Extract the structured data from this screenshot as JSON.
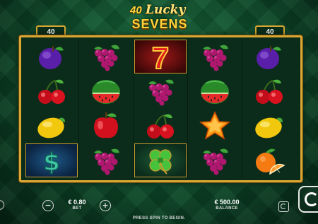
{
  "logo": {
    "number": "40",
    "line1": "Lucky",
    "line2": "SEVENS"
  },
  "paylines": {
    "left": "40",
    "right": "40"
  },
  "reels": [
    [
      "plum",
      "cherries",
      "lemon",
      "dollar"
    ],
    [
      "grapes",
      "watermelon",
      "apple",
      "grapes"
    ],
    [
      "seven",
      "grapes",
      "cherries",
      "clover"
    ],
    [
      "grapes",
      "watermelon",
      "star",
      "grapes"
    ],
    [
      "plum",
      "cherries",
      "lemon",
      "orange"
    ]
  ],
  "controls": {
    "bet_value": "€ 0.80",
    "bet_label": "BET",
    "minus_label": "−",
    "plus_label": "+",
    "balance_value": "€ 500.00",
    "balance_label": "BALANCE"
  },
  "message": "PRESS SPIN TO BEGIN.",
  "colors": {
    "frame": "#d9a634",
    "felt": "#0d4a2a"
  }
}
